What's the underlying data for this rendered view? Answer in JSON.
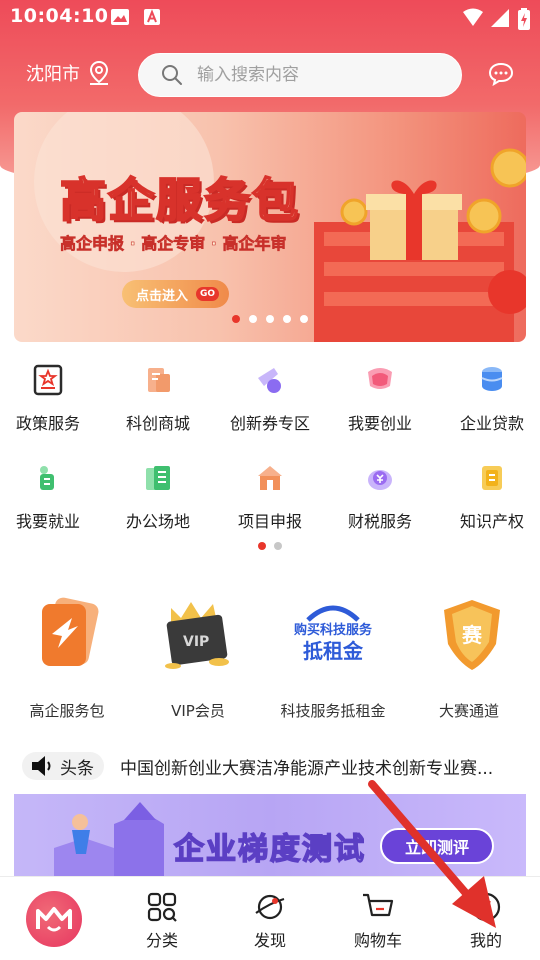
{
  "status_bar": {
    "time": "10:04:10"
  },
  "header": {
    "city": "沈阳市",
    "search_placeholder": "输入搜索内容"
  },
  "banner": {
    "title": "高企服务包",
    "subtitle": "高企申报 · 高企专审 · 高企年审",
    "cta": "点击进入",
    "go": "GO",
    "active_dot": 0,
    "dot_count": 5
  },
  "services": [
    {
      "label": "政策服务",
      "icon": "policy-icon",
      "color": "#e8362b"
    },
    {
      "label": "科创商城",
      "icon": "mall-icon",
      "color": "#f29a6b"
    },
    {
      "label": "创新券专区",
      "icon": "voucher-icon",
      "color": "#8b6cf1"
    },
    {
      "label": "我要创业",
      "icon": "startup-icon",
      "color": "#f25a7a"
    },
    {
      "label": "企业贷款",
      "icon": "loan-icon",
      "color": "#4a8df0"
    },
    {
      "label": "我要就业",
      "icon": "employment-icon",
      "color": "#3fbf6f"
    },
    {
      "label": "办公场地",
      "icon": "office-icon",
      "color": "#3fbf6f"
    },
    {
      "label": "项目申报",
      "icon": "project-icon",
      "color": "#f2905a"
    },
    {
      "label": "财税服务",
      "icon": "tax-icon",
      "color": "#9b6cf1"
    },
    {
      "label": "知识产权",
      "icon": "ip-icon",
      "color": "#f2b21b"
    }
  ],
  "featured": [
    {
      "label": "高企服务包"
    },
    {
      "label": "VIP会员"
    },
    {
      "label": "科技服务抵租金",
      "image_text_1": "购买科技服务",
      "image_text_2": "抵租金"
    },
    {
      "label": "大赛通道",
      "image_text": "赛"
    }
  ],
  "news": {
    "tag": "头条",
    "text": "中国创新创业大赛洁净能源产业技术创新专业赛..."
  },
  "ad": {
    "title": "企业梯度测试",
    "cta": "立即测评"
  },
  "bottom_nav": [
    {
      "label": "",
      "icon": "home-logo-icon"
    },
    {
      "label": "分类",
      "icon": "category-icon"
    },
    {
      "label": "发现",
      "icon": "discover-icon"
    },
    {
      "label": "购物车",
      "icon": "cart-icon"
    },
    {
      "label": "我的",
      "icon": "profile-icon"
    }
  ],
  "annotation": {
    "color": "#e0312b"
  }
}
